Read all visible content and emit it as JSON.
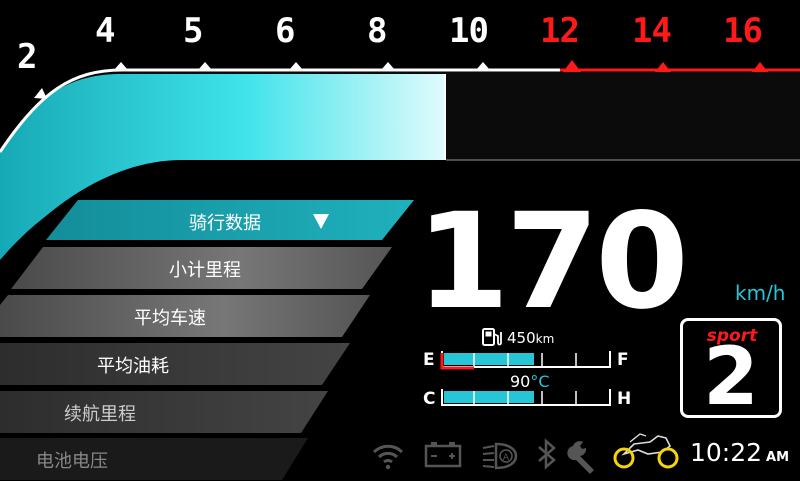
{
  "tachometer": {
    "labels": [
      "2",
      "4",
      "5",
      "6",
      "8",
      "10",
      "12",
      "14",
      "16"
    ],
    "redline_from": "12"
  },
  "menu": {
    "items": [
      {
        "label": "骑行数据",
        "selected": true
      },
      {
        "label": "小计里程",
        "selected": false
      },
      {
        "label": "平均车速",
        "selected": false
      },
      {
        "label": "平均油耗",
        "selected": false
      },
      {
        "label": "续航里程",
        "selected": false
      },
      {
        "label": "电池电压",
        "selected": false
      }
    ],
    "dropdown_icon": "triangle-down-icon"
  },
  "speed": {
    "value": "170",
    "unit": "km/h"
  },
  "fuel": {
    "range_value": "450",
    "range_unit": "km",
    "low_label": "E",
    "high_label": "F",
    "level": 0.55,
    "icon": "fuel-pump-icon"
  },
  "temperature": {
    "value": "90",
    "unit": "°C",
    "low_label": "C",
    "high_label": "H",
    "level": 0.55
  },
  "ride_mode": {
    "name": "sport",
    "number": "2"
  },
  "status_icons": [
    "wifi-icon",
    "battery-icon",
    "headlight-auto-icon",
    "bluetooth-icon",
    "wrench-icon",
    "motorcycle-icon"
  ],
  "clock": {
    "time": "10:22",
    "period": "AM"
  },
  "colors": {
    "accent": "#27c6d6",
    "redline": "#ff1a1a",
    "menu_selected": "#1a9aa6"
  }
}
